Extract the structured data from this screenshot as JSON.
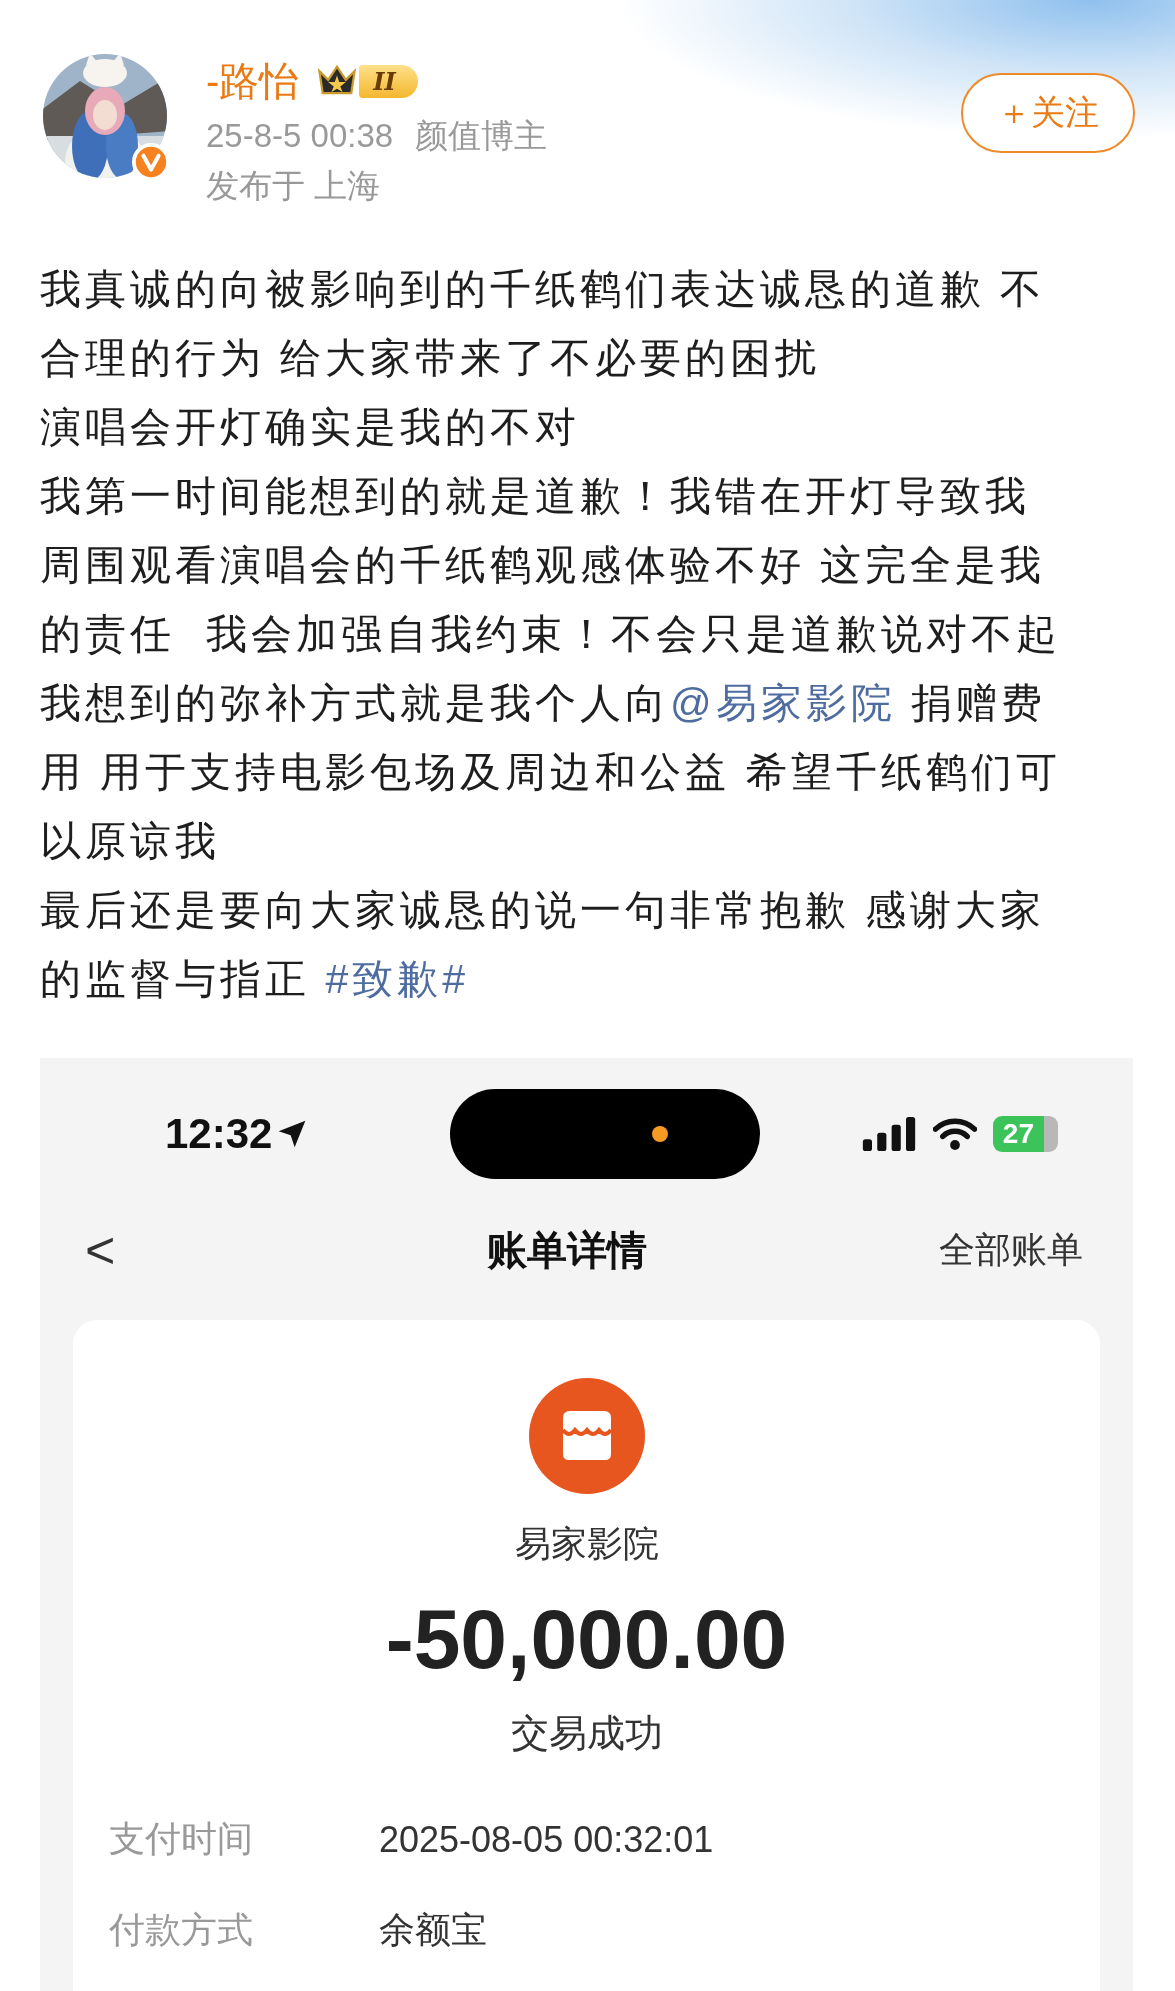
{
  "post": {
    "author": "-路怡",
    "rank_badge": "II",
    "verified": true,
    "time": "25-8-5 00:38",
    "tag": "颜值博主",
    "location": "发布于 上海",
    "follow_button": "＋关注"
  },
  "paragraphs": [
    [
      [
        {
          "kind": "text",
          "text": "我真诚的向被影响到的千纸鹤们表达诚恳的道歉 不"
        }
      ],
      [
        {
          "kind": "text",
          "text": "合理的行为 给大家带来了不必要的困扰"
        }
      ]
    ],
    [
      [
        {
          "kind": "text",
          "text": "演唱会开灯确实是我的不对"
        }
      ]
    ],
    [
      [
        {
          "kind": "text",
          "text": "我第一时间能想到的就是道歉！我错在开灯导致我"
        }
      ],
      [
        {
          "kind": "text",
          "text": "周围观看演唱会的千纸鹤观感体验不好 这完全是我"
        }
      ],
      [
        {
          "kind": "text",
          "text": "的责任  我会加强自我约束！不会只是道歉说对不起"
        }
      ]
    ],
    [
      [
        {
          "kind": "text",
          "text": "我想到的弥补方式就是我个人向"
        },
        {
          "kind": "mention",
          "text": "@易家影院"
        },
        {
          "kind": "text",
          "text": " 捐赠费"
        }
      ],
      [
        {
          "kind": "text",
          "text": "用 用于支持电影包场及周边和公益 希望千纸鹤们可"
        }
      ],
      [
        {
          "kind": "text",
          "text": "以原谅我"
        }
      ]
    ],
    [
      [
        {
          "kind": "text",
          "text": "最后还是要向大家诚恳的说一句非常抱歉 感谢大家"
        }
      ],
      [
        {
          "kind": "text",
          "text": "的监督与指正 "
        },
        {
          "kind": "hashtag",
          "text": "#致歉#"
        }
      ]
    ]
  ],
  "screenshot": {
    "status_bar": {
      "time": "12:32",
      "battery": "27"
    },
    "nav": {
      "back": "<",
      "title": "账单详情",
      "action": "全部账单"
    },
    "bill": {
      "merchant": "易家影院",
      "amount": "-50,000.00",
      "status": "交易成功",
      "rows": [
        {
          "label": "支付时间",
          "value": "2025-08-05 00:32:01"
        },
        {
          "label": "付款方式",
          "value": "余额宝"
        }
      ]
    }
  }
}
